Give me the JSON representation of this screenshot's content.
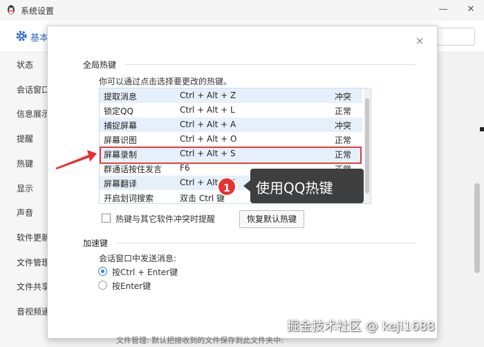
{
  "window": {
    "title": "系统设置",
    "header_tab": "基本",
    "controls": {
      "minimize": "—",
      "close": "✕"
    }
  },
  "sidebar": {
    "items": [
      {
        "label": "状态"
      },
      {
        "label": "会话窗口"
      },
      {
        "label": "信息展示"
      },
      {
        "label": "提醒"
      },
      {
        "label": "热键"
      },
      {
        "label": "显示"
      },
      {
        "label": "声音"
      },
      {
        "label": "软件更新"
      },
      {
        "label": "文件管理"
      },
      {
        "label": "文件共享"
      },
      {
        "label": "音视频通"
      }
    ]
  },
  "dialog": {
    "close": "×",
    "global_hotkeys": {
      "title": "全局热键",
      "hint": "你可以通过点击选择要更改的热键。",
      "rows": [
        {
          "name": "提取消息",
          "keys": "Ctrl + Alt + Z",
          "status": "冲突"
        },
        {
          "name": "锁定QQ",
          "keys": "Ctrl + Alt + L",
          "status": "正常"
        },
        {
          "name": "捕捉屏幕",
          "keys": "Ctrl + Alt + A",
          "status": "冲突"
        },
        {
          "name": "屏幕识图",
          "keys": "Ctrl + Alt + O",
          "status": "正常"
        },
        {
          "name": "屏幕录制",
          "keys": "Ctrl + Alt + S",
          "status": "正常"
        },
        {
          "name": "群通话按住发言",
          "keys": "F6",
          "status": "正常"
        },
        {
          "name": "屏幕翻译",
          "keys": "Ctrl + Alt + F",
          "status": "正常"
        },
        {
          "name": "开启划词搜索",
          "keys": "双击 Ctrl 键",
          "status": "正常"
        }
      ],
      "conflict_checkbox_label": "热键与其它软件冲突时提醒",
      "conflict_checkbox_checked": false,
      "restore_button": "恢复默认热键"
    },
    "accelerator": {
      "title": "加速键",
      "send_label": "会话窗口中发送消息:",
      "options": [
        {
          "label": "按Ctrl + Enter键",
          "checked": true
        },
        {
          "label": "按Enter键",
          "checked": false
        }
      ]
    }
  },
  "annotation": {
    "badge": "1",
    "callout_text": "使用QQ热键",
    "highlight_color": "#e03c3c"
  },
  "bottom_peek": "文件管理:     默认把接收到的文件保存到此文件夹中:",
  "watermark": "掘金技术社区 @ keji1688",
  "colors": {
    "accent": "#2a86e8",
    "row_alt": "#e6f0fb",
    "annotation_red": "#e8322e"
  }
}
